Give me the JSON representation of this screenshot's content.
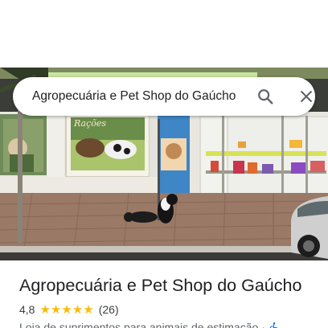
{
  "search": {
    "query": "Agropecuária e Pet Shop do Gaúcho",
    "search_icon": "search-icon",
    "close_icon": "close-icon"
  },
  "photo": {
    "sign_text": "Rações",
    "description_icon": "store-photo"
  },
  "place": {
    "title": "Agropecuária e Pet Shop do Gaúcho",
    "rating": "4,8",
    "stars": 5,
    "reviews": "(26)",
    "category": "Loja de suprimentos para animais de estimação",
    "separator": "·",
    "accessibility_icon": "wheelchair-icon"
  },
  "colors": {
    "star": "#fbbc04",
    "accessibility": "#1a73e8",
    "title": "#202124",
    "secondary": "#5f6368"
  }
}
